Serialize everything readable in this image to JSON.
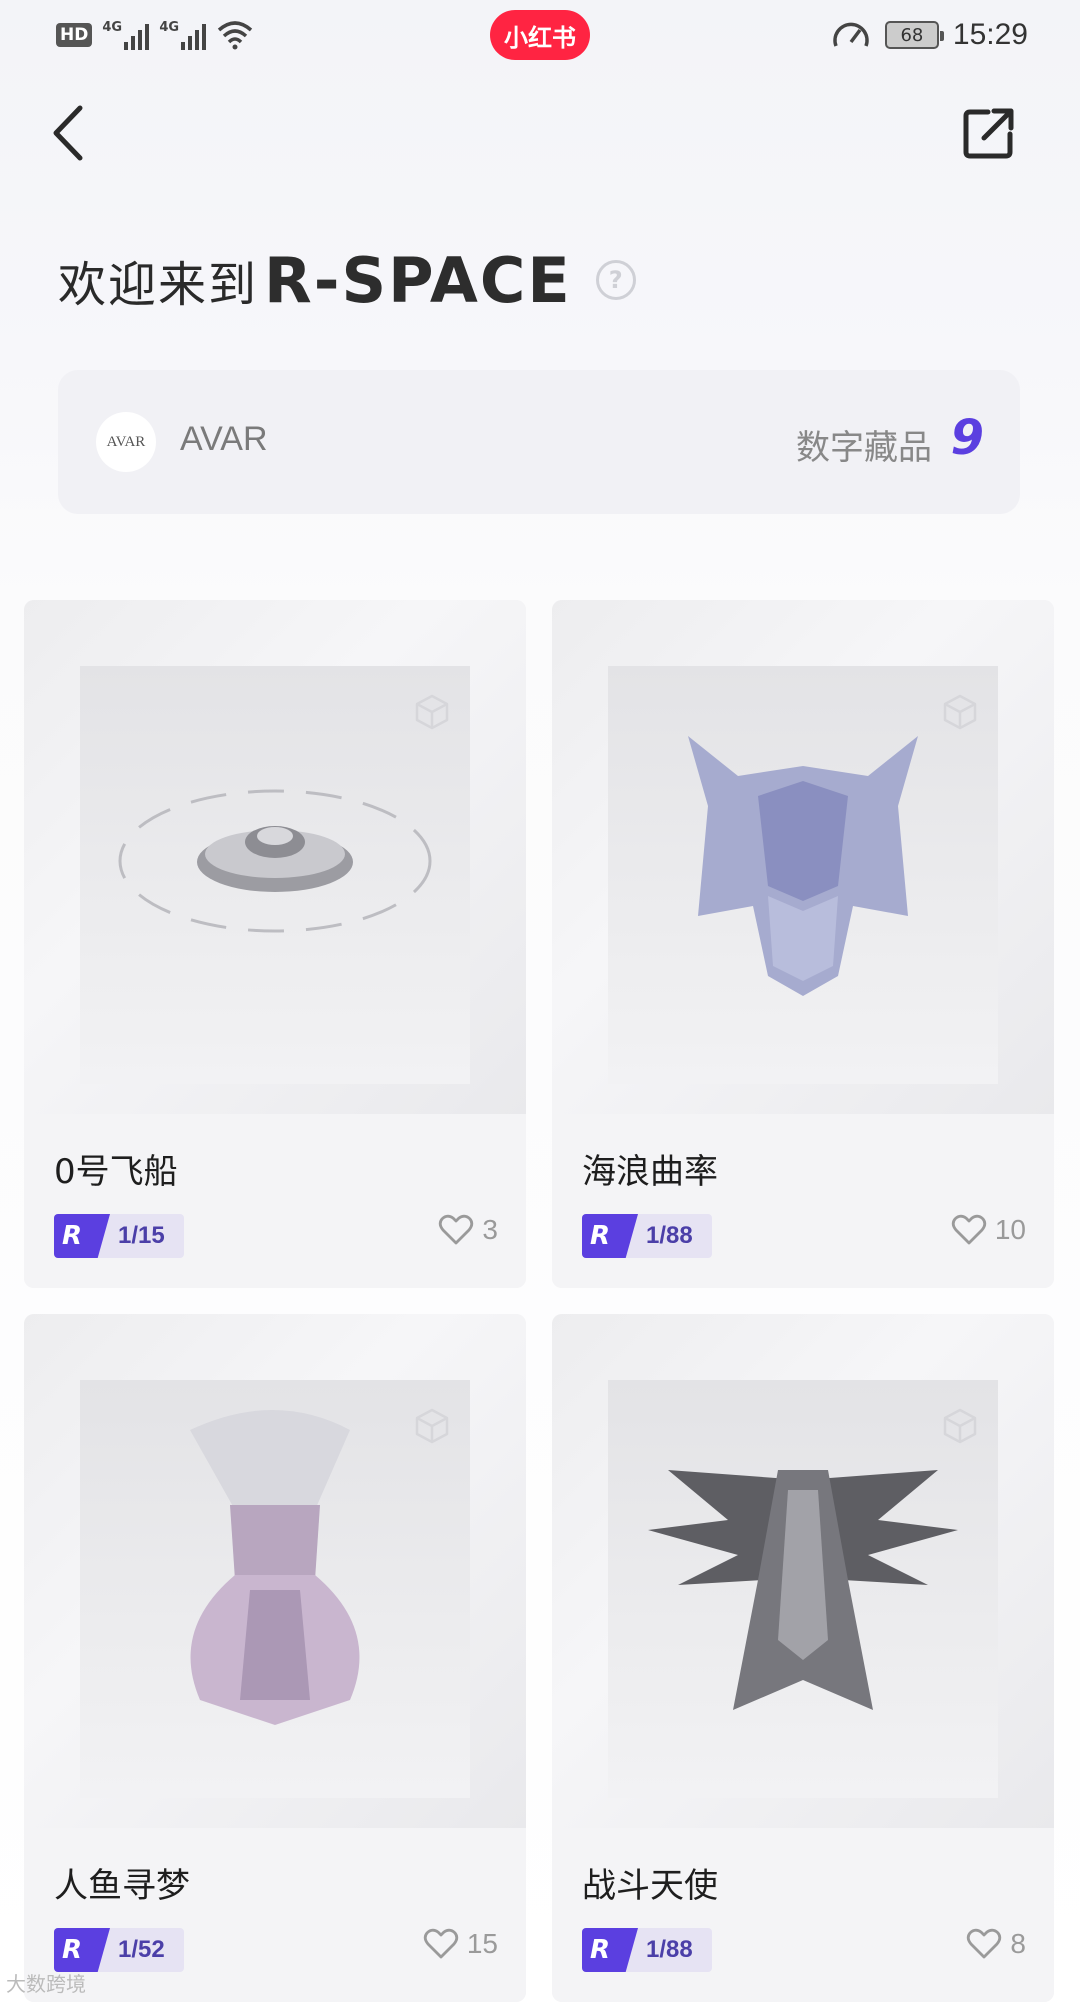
{
  "status_bar": {
    "hd": "HD",
    "signal_1": "4G",
    "signal_2": "4G",
    "app_badge": "小红书",
    "battery": "68",
    "time": "15:29"
  },
  "header": {
    "welcome": "欢迎来到",
    "brand": "R-SPACE",
    "help": "?"
  },
  "profile": {
    "avatar_text": "AVAR",
    "name": "AVAR",
    "collection_label": "数字藏品",
    "collection_count": "9"
  },
  "items": [
    {
      "title": "0号飞船",
      "edition": "1/15",
      "likes": "3"
    },
    {
      "title": "海浪曲率",
      "edition": "1/88",
      "likes": "10"
    },
    {
      "title": "人鱼寻梦",
      "edition": "1/52",
      "likes": "15"
    },
    {
      "title": "战斗天使",
      "edition": "1/88",
      "likes": "8"
    }
  ],
  "edition_badge_letter": "R",
  "colors": {
    "accent": "#5b3fe0",
    "app_red": "#ff2442"
  },
  "watermark": "大数跨境"
}
